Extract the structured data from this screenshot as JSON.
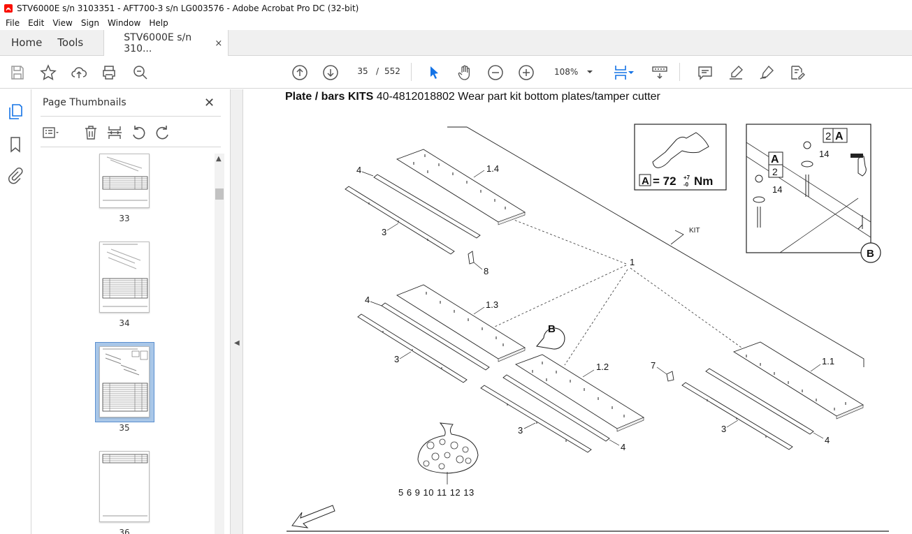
{
  "window": {
    "title": "STV6000E s/n 3103351 - AFT700-3 s/n LG003576 - Adobe Acrobat Pro DC (32-bit)"
  },
  "menu": [
    "File",
    "Edit",
    "View",
    "Sign",
    "Window",
    "Help"
  ],
  "tabs": {
    "home": "Home",
    "tools": "Tools",
    "document": "STV6000E s/n 310...",
    "close": "×"
  },
  "toolbar": {
    "page_current": "35",
    "page_separator": "/",
    "page_total": "552",
    "zoom": "108%"
  },
  "thumbnails_panel": {
    "title": "Page Thumbnails",
    "pages": [
      {
        "label": "33"
      },
      {
        "label": "34"
      },
      {
        "label": "35",
        "selected": true
      },
      {
        "label": "36"
      }
    ]
  },
  "document": {
    "heading_bold": "Plate / bars KITS",
    "heading_rest": " 40-4812018802 Wear part kit bottom plates/tamper cutter",
    "torque_label": "A",
    "torque_value": "= 72",
    "torque_tol_plus": "+7",
    "torque_tol_minus": "-0",
    "torque_unit": "Nm",
    "callouts": [
      "1.4",
      "1.3",
      "1.2",
      "1.1",
      "1",
      "3",
      "4",
      "7",
      "8",
      "14",
      "2",
      "A",
      "B",
      "KIT"
    ],
    "parts_bag_label": "5 6 9 10 11 12 13"
  },
  "colors": {
    "accent": "#1473e6",
    "selection": "#a9c7e8"
  }
}
